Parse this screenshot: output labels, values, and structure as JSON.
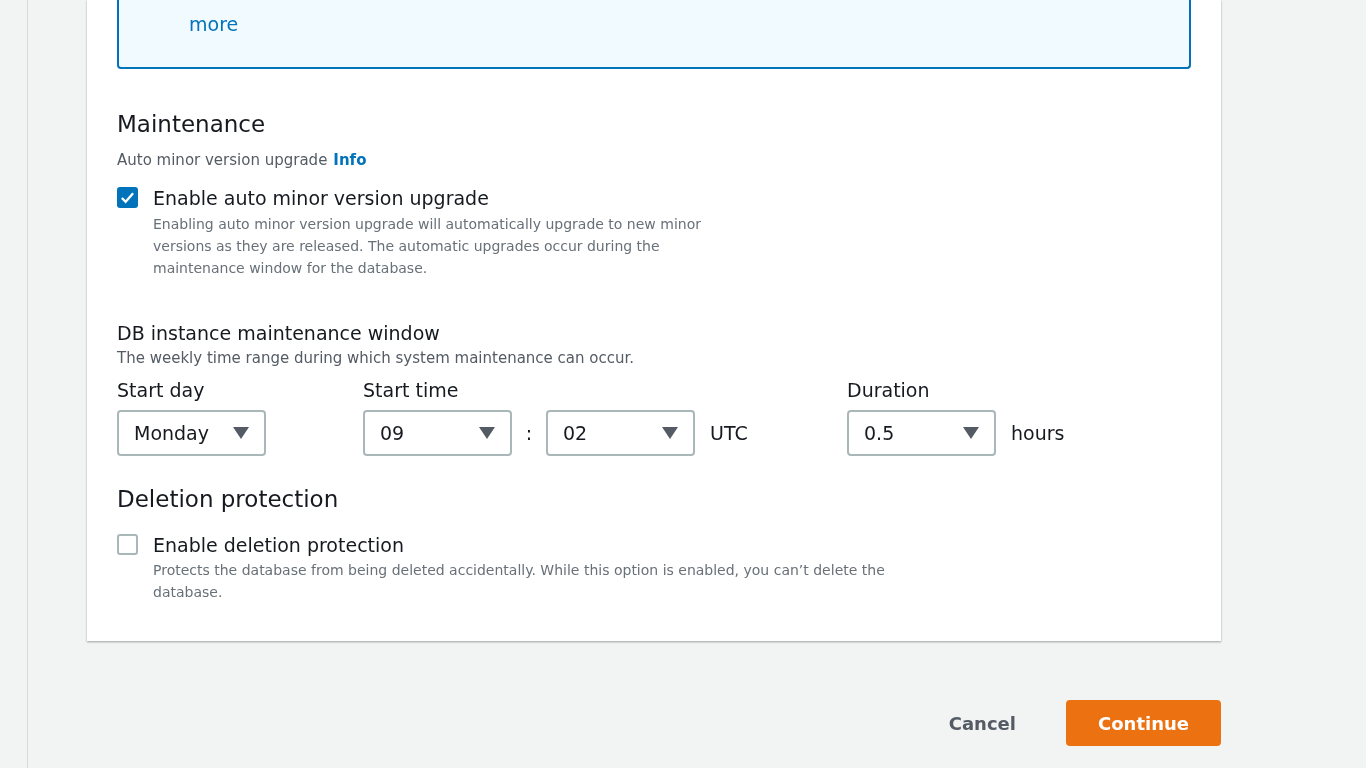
{
  "alert": {
    "link": "more"
  },
  "maintenance": {
    "title": "Maintenance",
    "label": "Auto minor version upgrade",
    "info": "Info",
    "option": {
      "label": "Enable auto minor version upgrade",
      "description": "Enabling auto minor version upgrade will automatically upgrade to new minor versions as they are released. The automatic upgrades occur during the maintenance window for the database.",
      "checked": true
    }
  },
  "window": {
    "title": "DB instance maintenance window",
    "description": "The weekly time range during which system maintenance can occur.",
    "start_day": {
      "label": "Start day",
      "value": "Monday"
    },
    "start_time": {
      "label": "Start time",
      "hour": "09",
      "separator": ":",
      "minute": "02",
      "unit": "UTC"
    },
    "duration": {
      "label": "Duration",
      "value": "0.5",
      "unit": "hours"
    }
  },
  "deletion": {
    "title": "Deletion protection",
    "option": {
      "label": "Enable deletion protection",
      "description": "Protects the database from being deleted accidentally. While this option is enabled, you can’t delete the database.",
      "checked": false
    }
  },
  "buttons": {
    "cancel": "Cancel",
    "continue": "Continue"
  }
}
